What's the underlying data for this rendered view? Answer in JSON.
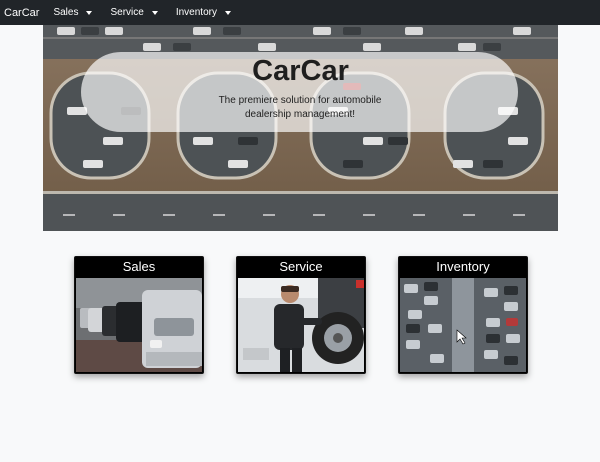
{
  "navbar": {
    "brand": "CarCar",
    "items": [
      {
        "label": "Sales"
      },
      {
        "label": "Service"
      },
      {
        "label": "Inventory"
      }
    ]
  },
  "hero": {
    "title": "CarCar",
    "subtitle": "The premiere solution for automobile dealership management!"
  },
  "cards": [
    {
      "title": "Sales",
      "image": "car-dealership-lot-photo"
    },
    {
      "title": "Service",
      "image": "mechanic-changing-tire-photo"
    },
    {
      "title": "Inventory",
      "image": "automated-parking-garage-photo"
    }
  ],
  "colors": {
    "navbar_bg": "#212529",
    "page_bg": "#f8f9fa",
    "card_bg": "#000000"
  }
}
